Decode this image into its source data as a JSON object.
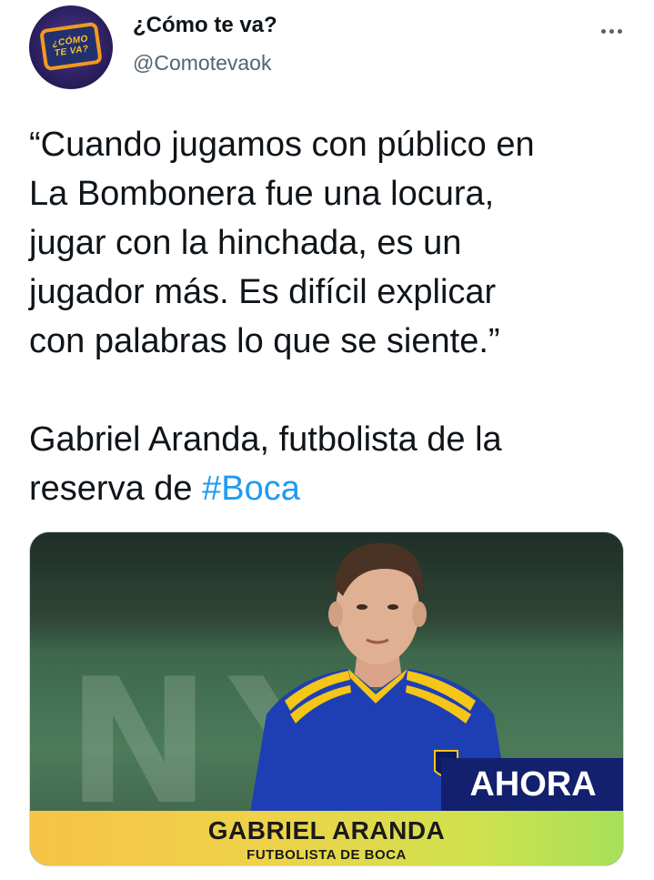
{
  "account": {
    "display_name": "¿Cómo te va?",
    "handle": "@Comotevaok",
    "avatar_badge_line1": "¿CÓMO",
    "avatar_badge_line2": "TE VA?"
  },
  "tweet": {
    "quote_lines": [
      "“Cuando jugamos con público en",
      "La Bombonera fue una locura,",
      "jugar con la hinchada, es un",
      "jugador más. Es difícil explicar",
      "con palabras lo que se siente.”"
    ],
    "attribution_line1": "Gabriel Aranda, futbolista de la",
    "attribution_line2_prefix": "reserva de ",
    "hashtag": "#Boca"
  },
  "media": {
    "badge": "AHORA",
    "caption_name": "GABRIEL ARANDA",
    "caption_role": "FUTBOLISTA DE BOCA",
    "background_letters": "NY"
  },
  "colors": {
    "hashtag": "#1d9bf0",
    "handle": "#536471",
    "badge_bg": "#12206e"
  }
}
